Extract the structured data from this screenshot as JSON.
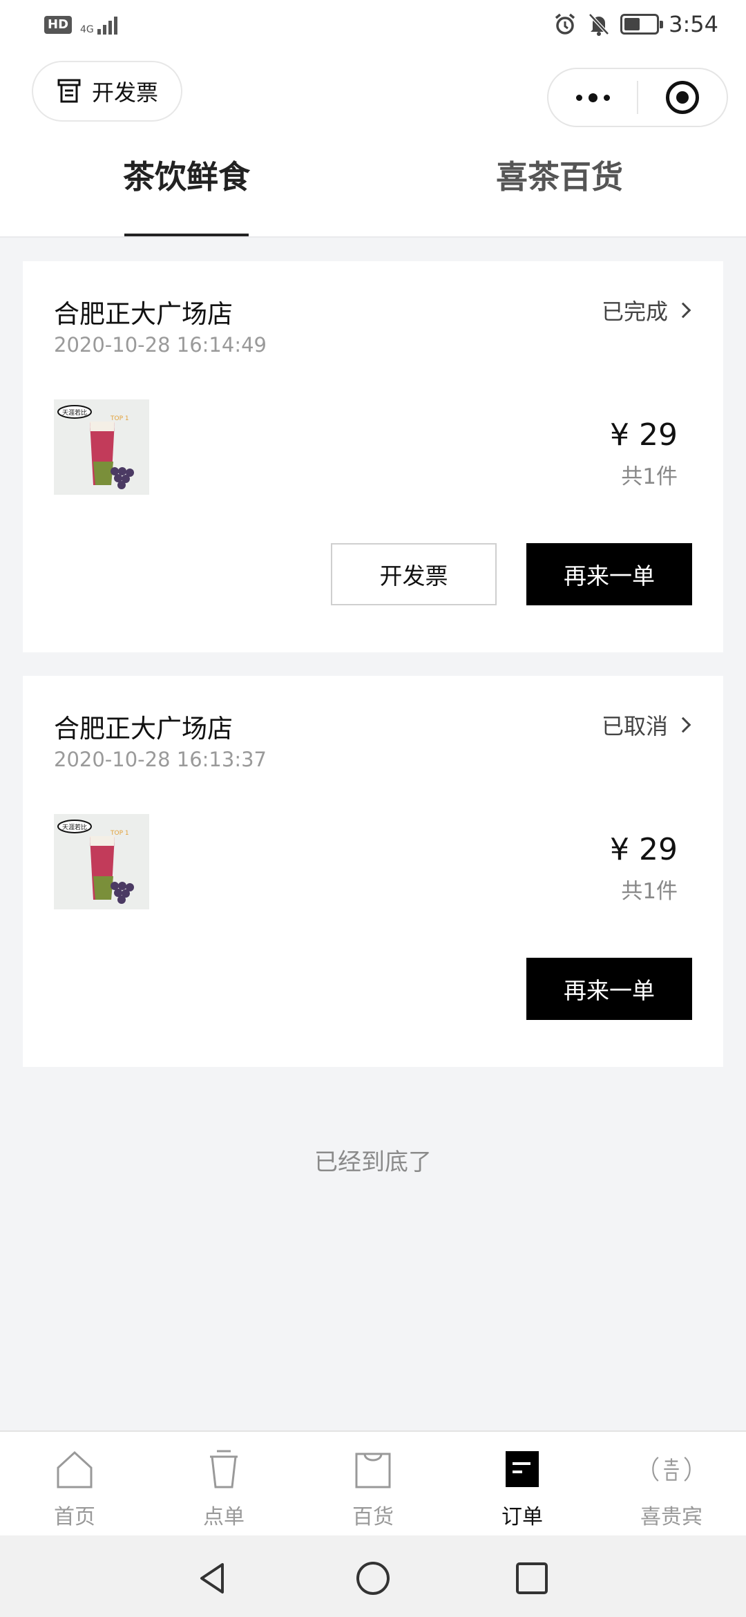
{
  "status_bar": {
    "hd": "HD",
    "network": "4G",
    "time": "3:54"
  },
  "header": {
    "invoice_label": "开发票",
    "tabs": [
      {
        "label": "茶饮鲜食",
        "active": true
      },
      {
        "label": "喜茶百货",
        "active": false
      }
    ]
  },
  "orders": [
    {
      "store": "合肥正大广场店",
      "datetime": "2020-10-28 16:14:49",
      "status": "已完成",
      "price": "¥ 29",
      "count": "共1件",
      "invoice_button": "开发票",
      "reorder_button": "再来一单",
      "product_image": "grape-tea-drink",
      "image_badge": "天涯若比",
      "image_tag": "TOP 1"
    },
    {
      "store": "合肥正大广场店",
      "datetime": "2020-10-28 16:13:37",
      "status": "已取消",
      "price": "¥ 29",
      "count": "共1件",
      "reorder_button": "再来一单",
      "product_image": "grape-tea-drink",
      "image_badge": "天涯若比",
      "image_tag": "TOP 1"
    }
  ],
  "end_text": "已经到底了",
  "bottom_nav": [
    {
      "label": "首页",
      "icon": "home-icon",
      "active": false
    },
    {
      "label": "点单",
      "icon": "cup-icon",
      "active": false
    },
    {
      "label": "百货",
      "icon": "bag-icon",
      "active": false
    },
    {
      "label": "订单",
      "icon": "order-icon",
      "active": true
    },
    {
      "label": "喜贵宾",
      "icon": "vip-icon",
      "active": false
    }
  ],
  "system_nav": [
    "back-icon",
    "home-circle-icon",
    "recents-icon"
  ],
  "colors": {
    "background": "#f3f4f6",
    "primary": "#000000",
    "muted": "#999999"
  }
}
